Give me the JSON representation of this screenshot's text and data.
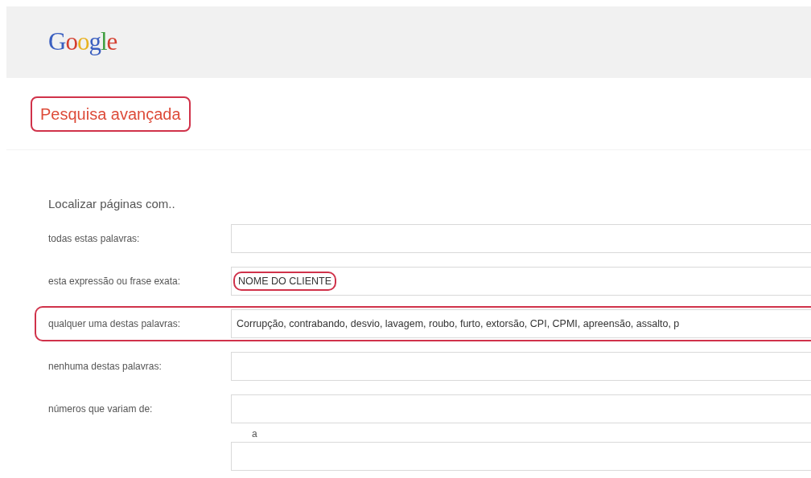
{
  "header": {
    "logo": "Google"
  },
  "title": {
    "text": "Pesquisa avançada",
    "highlighted": true
  },
  "section": {
    "heading": "Localizar páginas com.."
  },
  "rows": [
    {
      "label": "todas estas palavras:",
      "highlighted": false
    },
    {
      "label": "esta expressão ou frase exata:",
      "value": "NOME DO CLIENTE",
      "value_highlighted": true,
      "highlighted": false
    },
    {
      "label": "qualquer uma destas palavras:",
      "value": "Corrupção, contrabando, desvio, lavagem, roubo, furto, extorsão, CPI, CPMI, apreensão, assalto, p",
      "highlighted": true
    },
    {
      "label": "nenhuma destas palavras:",
      "highlighted": false
    },
    {
      "label": "números que variam de:",
      "highlighted": false
    }
  ],
  "range": {
    "separator": "a"
  }
}
